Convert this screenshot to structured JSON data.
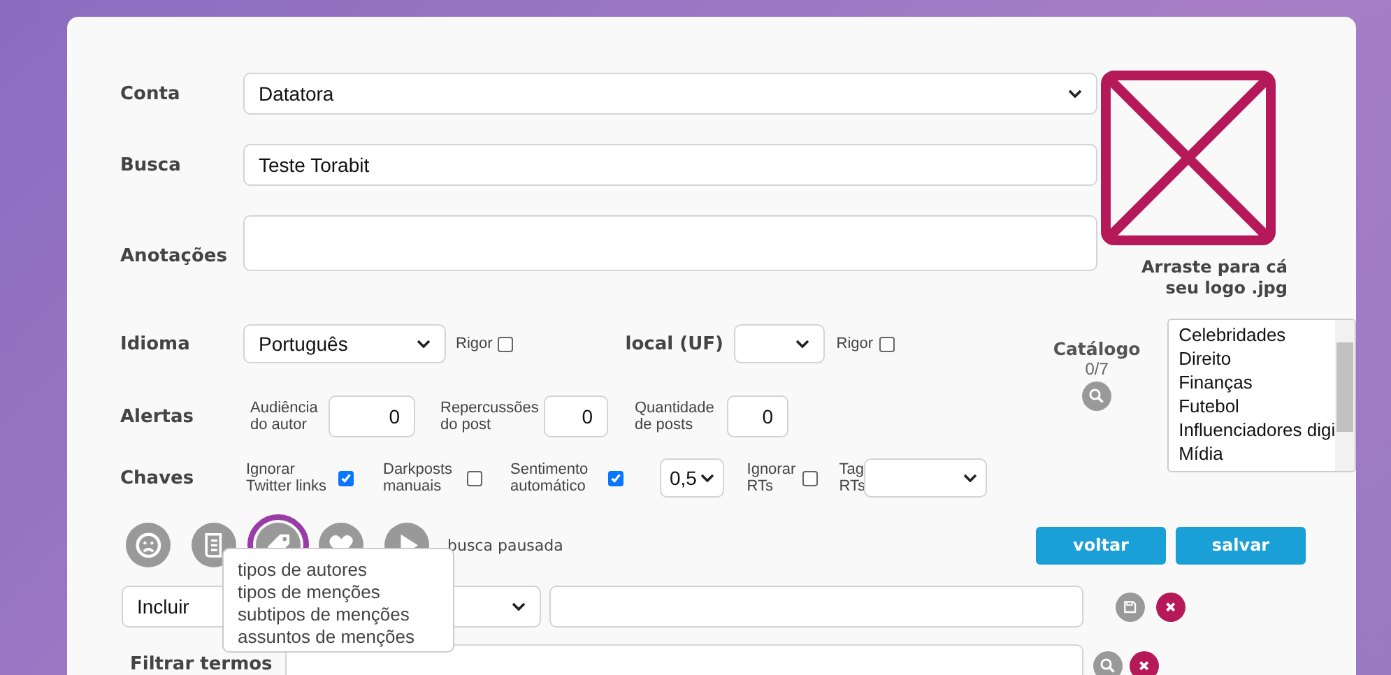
{
  "account": {
    "label": "Conta",
    "value": "Datatora"
  },
  "search": {
    "label": "Busca",
    "value": "Teste Torabit"
  },
  "notes": {
    "label": "Anotações"
  },
  "logo": {
    "caption": "Arraste para cá seu logo .jpg"
  },
  "language": {
    "label": "Idioma",
    "value": "Português",
    "rigor": {
      "label": "Rigor",
      "checked": false
    }
  },
  "location": {
    "label": "local (UF)",
    "rigor": {
      "label": "Rigor",
      "checked": false
    }
  },
  "alerts": {
    "label": "Alertas",
    "fields": [
      {
        "label": "Audiência do autor",
        "value": "0"
      },
      {
        "label": "Repercussões do post",
        "value": "0"
      },
      {
        "label": "Quantidade de posts",
        "value": "0"
      }
    ]
  },
  "keys": {
    "label": "Chaves",
    "options": [
      {
        "kind": "checkbox",
        "label": "Ignorar Twitter links",
        "checked": true
      },
      {
        "kind": "checkbox",
        "label": "Darkposts manuais",
        "checked": false
      },
      {
        "kind": "checkbox",
        "label": "Sentimento automático",
        "checked": true
      },
      {
        "kind": "select",
        "value": "0,5"
      },
      {
        "kind": "checkbox",
        "label": "Ignorar RTs",
        "checked": false
      },
      {
        "kind": "select",
        "label": "Tag RTs"
      }
    ]
  },
  "catalog": {
    "title": "Catálogo",
    "count": "0/7"
  },
  "categories": [
    "Celebridades",
    "Direito",
    "Finanças",
    "Futebol",
    "Influenciadores digi",
    "Mídia"
  ],
  "toolbar": {
    "icons": [
      {
        "kind": "sad",
        "highlighted": false
      },
      {
        "kind": "scroll",
        "highlighted": false
      },
      {
        "kind": "tag",
        "highlighted": true
      },
      {
        "kind": "heart",
        "highlighted": false
      },
      {
        "kind": "play",
        "highlighted": false
      }
    ],
    "status": "busca pausada"
  },
  "tag_menu": {
    "items": [
      "tipos de autores",
      "tipos de menções",
      "subtipos de menções",
      "assuntos de menções"
    ]
  },
  "buttons": [
    "voltar",
    "salvar"
  ],
  "filter": {
    "mode": "Incluir"
  },
  "filter_terms": {
    "label": "Filtrar termos"
  }
}
